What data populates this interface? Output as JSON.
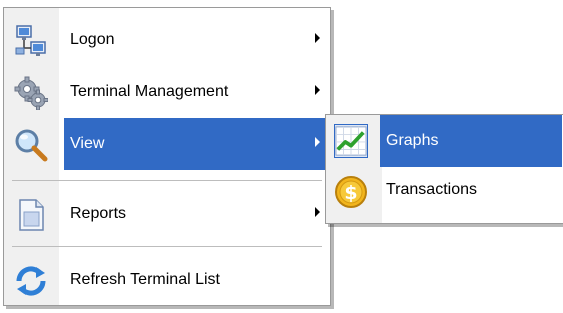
{
  "menu": {
    "items": [
      {
        "label": "Logon",
        "icon": "network-computers-icon",
        "has_submenu": true
      },
      {
        "label": "Terminal Management",
        "icon": "gears-icon",
        "has_submenu": true
      },
      {
        "label": "View",
        "icon": "magnifier-icon",
        "has_submenu": true,
        "highlighted": true
      },
      {
        "label": "Reports",
        "icon": "document-icon",
        "has_submenu": true
      },
      {
        "label": "Refresh Terminal List",
        "icon": "refresh-arrows-icon",
        "has_submenu": false
      }
    ]
  },
  "submenu": {
    "items": [
      {
        "label": "Graphs",
        "icon": "chart-icon",
        "highlighted": true
      },
      {
        "label": "Transactions",
        "icon": "dollar-coin-icon",
        "highlighted": false
      }
    ]
  },
  "colors": {
    "highlight": "#316ac5",
    "gutter": "#f0f0f0",
    "separator": "#bdbdbd"
  }
}
